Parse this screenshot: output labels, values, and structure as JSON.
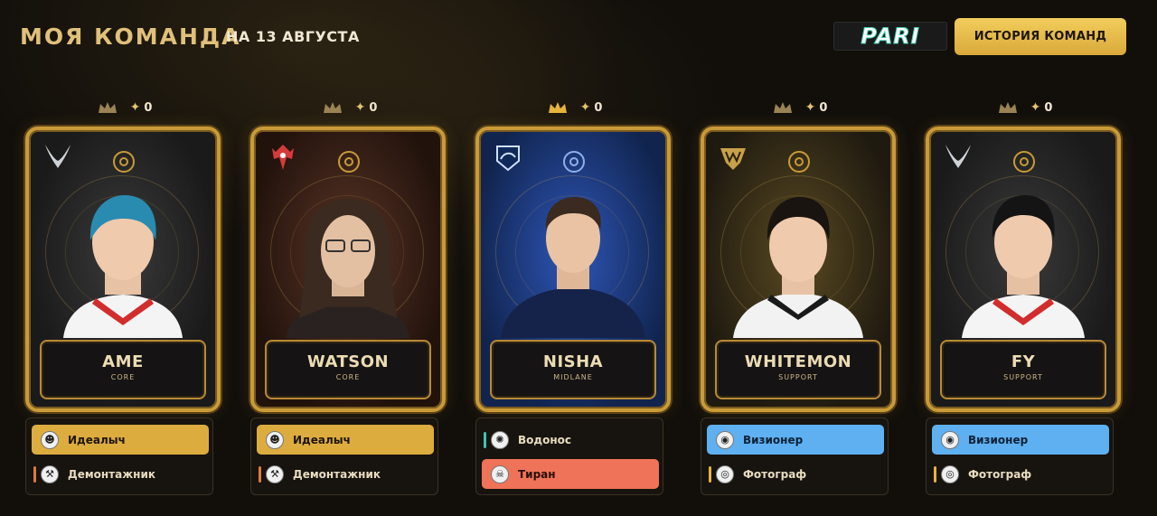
{
  "header": {
    "title": "МОЯ КОМАНДА",
    "subtitle": "НА 13 АВГУСТА",
    "brand": "PARI",
    "history_button": "ИСТОРИЯ КОМАНД"
  },
  "colors": {
    "gold_accent": "#e0c07a",
    "button_gold": "#f2cd5c",
    "perk_gold": "#ddac3f",
    "perk_blue": "#5eb0f0",
    "perk_red": "#ef7358",
    "bar_orange": "#e07a3a",
    "bar_teal": "#3ec6b0",
    "bar_yellow": "#e5b43d"
  },
  "players": [
    {
      "name": "AME",
      "role": "CORE",
      "points": "0",
      "card_theme": "dark",
      "team_icon": "xtreme-gaming-icon",
      "perks": [
        {
          "label": "Идеалыч",
          "icon": "idealych-icon",
          "highlight": "gold"
        },
        {
          "label": "Демонтажник",
          "icon": "demolisher-icon",
          "highlight": "none",
          "bar": "orange"
        }
      ]
    },
    {
      "name": "WATSON",
      "role": "CORE",
      "points": "0",
      "card_theme": "brown",
      "team_icon": "entity-icon",
      "perks": [
        {
          "label": "Идеалыч",
          "icon": "idealych-icon",
          "highlight": "gold"
        },
        {
          "label": "Демонтажник",
          "icon": "demolisher-icon",
          "highlight": "none",
          "bar": "orange"
        }
      ]
    },
    {
      "name": "NISHA",
      "role": "MIDLANE",
      "points": "0",
      "card_theme": "blue",
      "team_icon": "team-liquid-icon",
      "perks": [
        {
          "label": "Водонос",
          "icon": "water-carrier-icon",
          "highlight": "none",
          "bar": "teal"
        },
        {
          "label": "Тиран",
          "icon": "tyrant-icon",
          "highlight": "red"
        }
      ]
    },
    {
      "name": "WHITEMON",
      "role": "SUPPORT",
      "points": "0",
      "card_theme": "gold",
      "team_icon": "talon-icon",
      "perks": [
        {
          "label": "Визионер",
          "icon": "visionary-icon",
          "highlight": "blue"
        },
        {
          "label": "Фотограф",
          "icon": "photographer-icon",
          "highlight": "none",
          "bar": "yellow"
        }
      ]
    },
    {
      "name": "FY",
      "role": "SUPPORT",
      "points": "0",
      "card_theme": "dark",
      "team_icon": "xtreme-gaming-icon",
      "perks": [
        {
          "label": "Визионер",
          "icon": "visionary-icon",
          "highlight": "blue"
        },
        {
          "label": "Фотограф",
          "icon": "photographer-icon",
          "highlight": "none",
          "bar": "yellow"
        }
      ]
    }
  ]
}
